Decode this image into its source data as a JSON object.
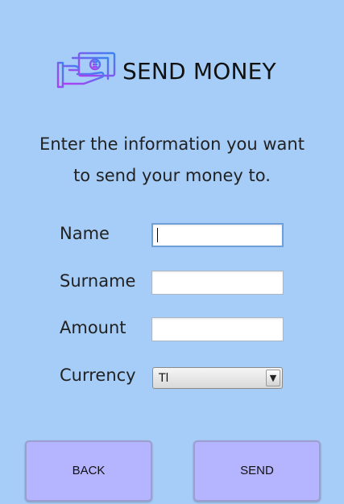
{
  "header": {
    "title": "SEND MONEY",
    "logo_icon": "money-hand-icon"
  },
  "instructions": {
    "line1": "Enter the information you want",
    "line2": "to send your money to."
  },
  "form": {
    "name_label": "Name",
    "name_value": "",
    "surname_label": "Surname",
    "surname_value": "",
    "amount_label": "Amount",
    "amount_value": "",
    "currency_label": "Currency",
    "currency_selected": "Tl"
  },
  "buttons": {
    "back_label": "BACK",
    "send_label": "SEND"
  },
  "colors": {
    "background": "#a6cdf8",
    "button": "#b5b4ff",
    "icon_gradient_start": "#b43cf0",
    "icon_gradient_end": "#3c82f0"
  }
}
